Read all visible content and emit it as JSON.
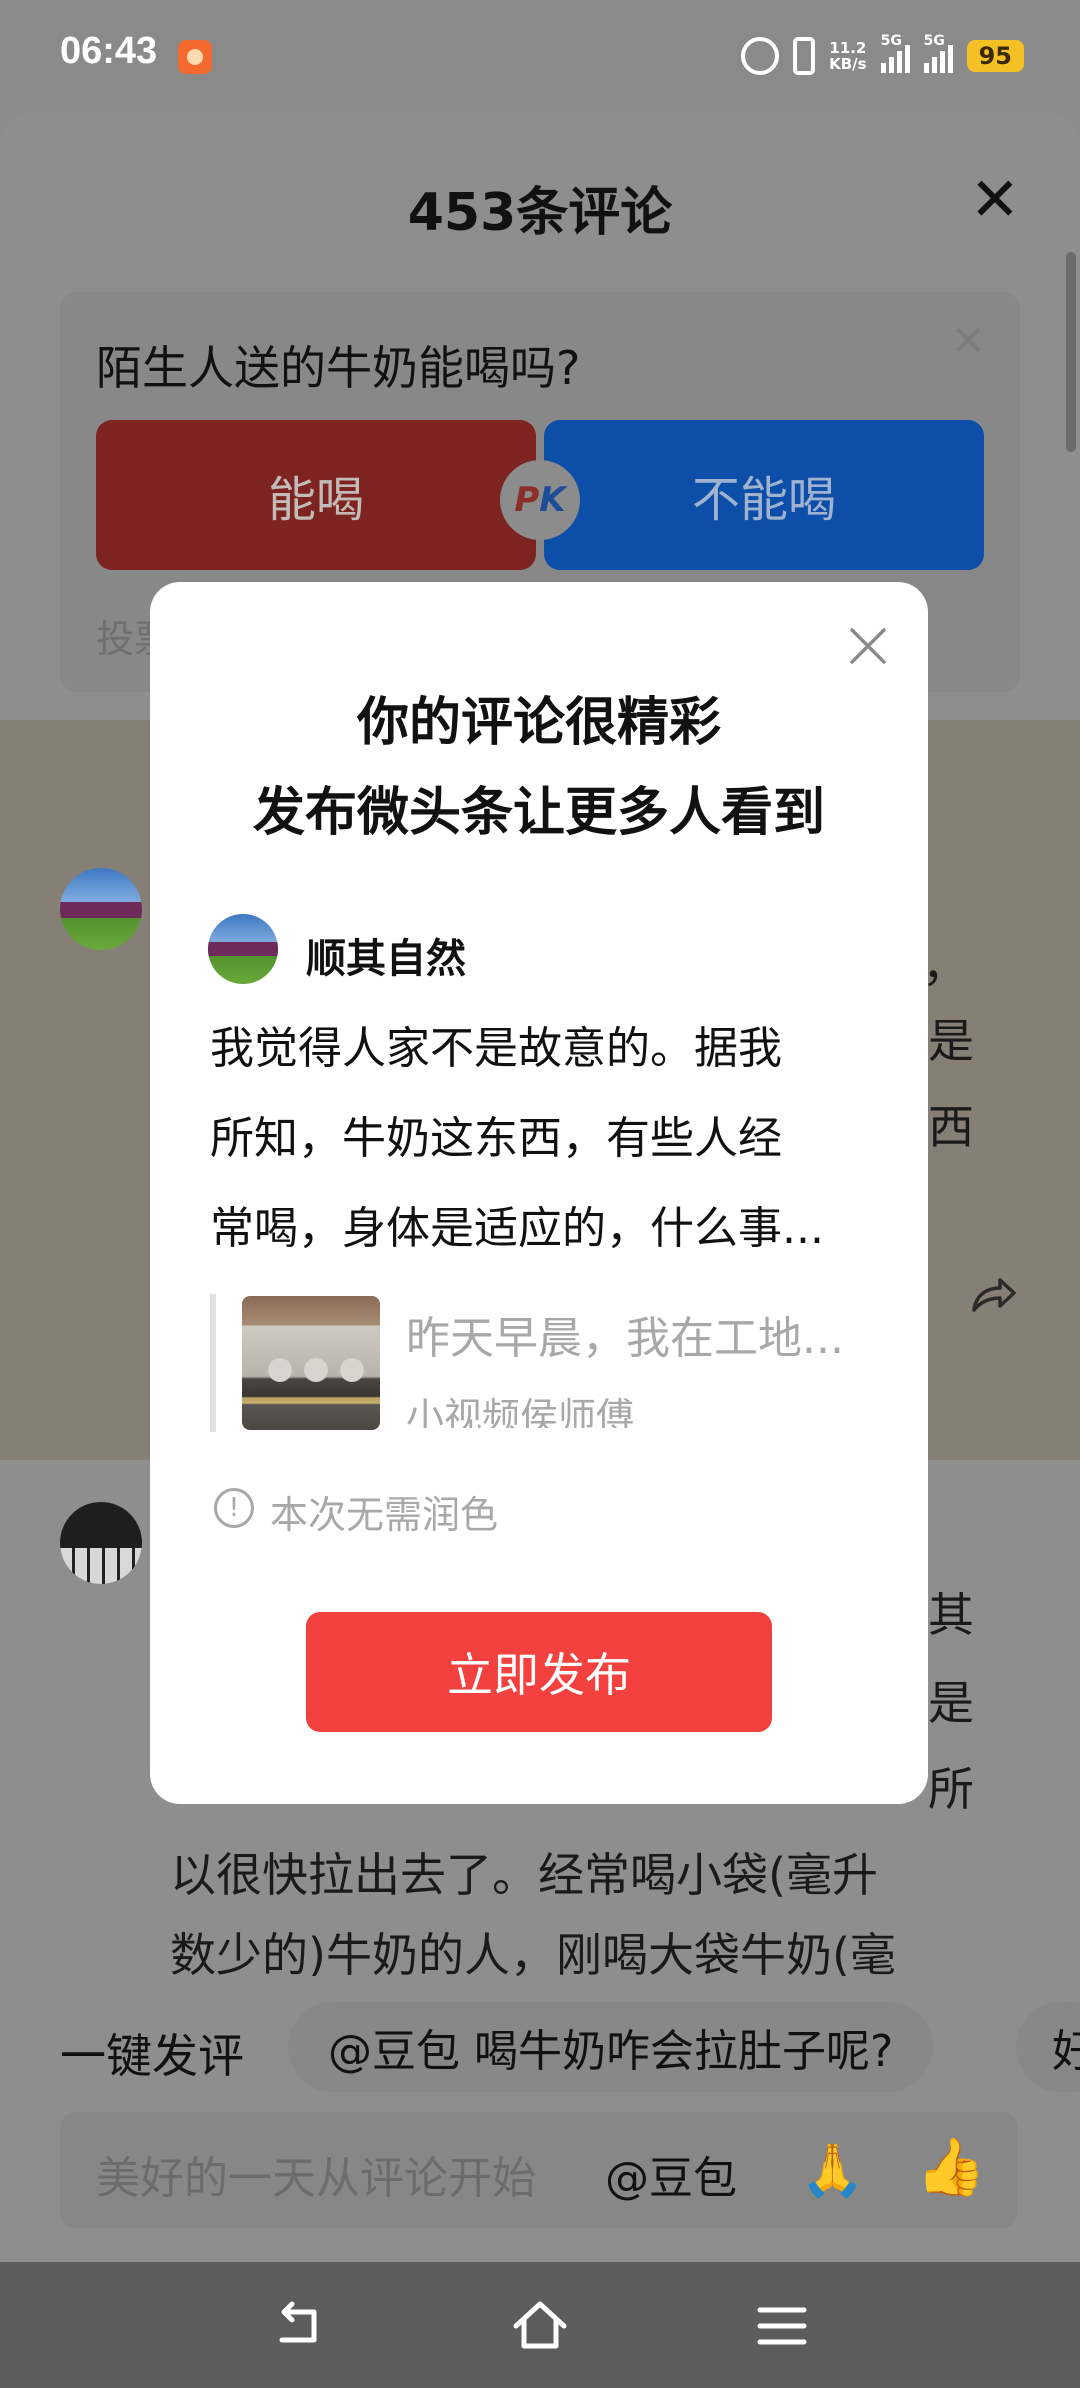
{
  "status_bar": {
    "time": "06:43",
    "net_speed_value": "11.2",
    "net_speed_unit": "KB/s",
    "signal1_label": "5G",
    "signal2_label": "5G",
    "battery": "95"
  },
  "sheet": {
    "title": "453条评论",
    "poll": {
      "question": "陌生人送的牛奶能喝吗?",
      "option_yes": "能喝",
      "pk_p": "P",
      "pk_k": "K",
      "option_no": "不能喝",
      "vote_label": "投票"
    },
    "background_comments": {
      "c1_fragments": [
        "，",
        "是",
        "西"
      ],
      "c2_fragments": [
        "其",
        "是",
        "所"
      ],
      "c2_line1": "以很快拉出去了。经常喝小袋(毫升",
      "c2_line2": "数少的)牛奶的人，刚喝大袋牛奶(毫"
    }
  },
  "modal": {
    "title_line1": "你的评论很精彩",
    "title_line2": "发布微头条让更多人看到",
    "author": "顺其自然",
    "comment_lines": [
      "我觉得人家不是故意的。据我",
      "所知，牛奶这东西，有些人经",
      "常喝，身体是适应的，什么事..."
    ],
    "quote_title": "昨天早晨，我在工地...",
    "quote_author": "小视频侯师傅",
    "notice": "本次无需润色",
    "publish_button": "立即发布"
  },
  "quick_reply": {
    "label": "一键发评",
    "chip1": "@豆包 喝牛奶咋会拉肚子呢?",
    "chip2": "好"
  },
  "input": {
    "placeholder": "美好的一天从评论开始",
    "mention": "@豆包",
    "emoji1": "🙏",
    "emoji2": "👍"
  },
  "colors": {
    "publish": "#f34140",
    "battery": "#f5c023",
    "pk_yes": "#7e2420",
    "pk_no": "#0c4ea8"
  }
}
